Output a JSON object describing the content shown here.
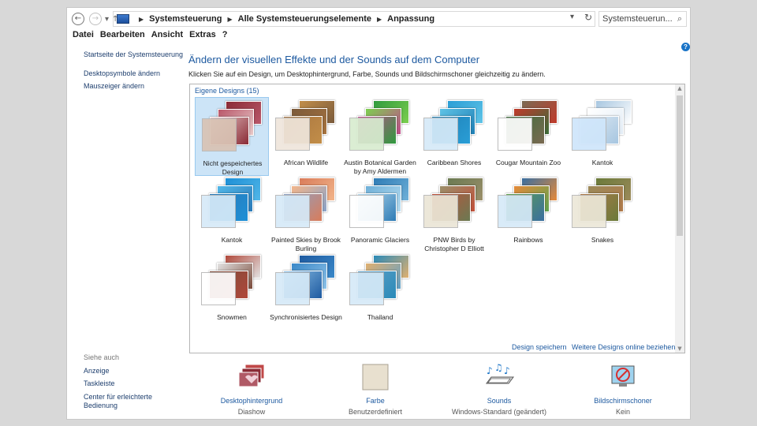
{
  "nav": {
    "back_icon": "arrow-left-icon",
    "forward_icon": "arrow-right-icon",
    "recent_icon": "chevron-down-icon",
    "up_icon": "arrow-up-icon"
  },
  "breadcrumb": [
    "Systemsteuerung",
    "Alle Systemsteuerungselemente",
    "Anpassung"
  ],
  "search": {
    "placeholder": "Systemsteuerun..."
  },
  "menu": [
    "Datei",
    "Bearbeiten",
    "Ansicht",
    "Extras",
    "?"
  ],
  "sidebar": {
    "links": [
      "Startseite der Systemsteuerung",
      "Desktopsymbole ändern",
      "Mauszeiger ändern"
    ],
    "see_also_title": "Siehe auch",
    "see_also": [
      "Anzeige",
      "Taskleiste",
      "Center für erleichterte Bedienung"
    ]
  },
  "main": {
    "title": "Ändern der visuellen Effekte und der Sounds auf dem Computer",
    "subtitle": "Klicken Sie auf ein Design, um Desktophintergrund, Farbe, Sounds und Bildschirmschoner gleichzeitig zu ändern.",
    "group_title": "Eigene Designs (15)",
    "themes": [
      {
        "label": "Nicht gespeichertes Design",
        "selected": true,
        "colors": [
          "#8a2b36",
          "#b9576a",
          "#e8c9c9",
          "#d9c3b4"
        ]
      },
      {
        "label": "African Wildlife",
        "colors": [
          "#c28e49",
          "#7a5a3b",
          "#a8743f",
          "#efe6dc"
        ]
      },
      {
        "label": "Austin Botanical Garden by Amy Aldermen",
        "colors": [
          "#2f9a3e",
          "#7ccf4f",
          "#c24b8d",
          "#d8ecd0"
        ]
      },
      {
        "label": "Caribbean Shores",
        "colors": [
          "#2a9ed6",
          "#5fc3e6",
          "#1e7fb5",
          "#d6eaf8"
        ]
      },
      {
        "label": "Cougar Mountain Zoo",
        "colors": [
          "#7a6a52",
          "#c03a2b",
          "#3a6d3a",
          "#ffffff"
        ]
      },
      {
        "label": "Kantok",
        "colors": [
          "#a7c6e0",
          "#ffffff",
          "#e2ecf5",
          "#cfe6fb"
        ]
      },
      {
        "label": "Kantok",
        "colors": [
          "#1d8fd6",
          "#52b7e8",
          "#2a7ab8",
          "#d6eaf8"
        ]
      },
      {
        "label": "Painted Skies by Brook Burling",
        "colors": [
          "#d97c5a",
          "#f2b58a",
          "#8aa3c9",
          "#d6eaf8"
        ]
      },
      {
        "label": "Panoramic Glaciers",
        "colors": [
          "#2e7bb5",
          "#6fb0d8",
          "#b6dcf0",
          "#ffffff"
        ]
      },
      {
        "label": "PNW Birds by Christopher D Elliott",
        "colors": [
          "#6a7a52",
          "#9b8f6a",
          "#c2503a",
          "#ebe6d6"
        ]
      },
      {
        "label": "Rainbows",
        "colors": [
          "#3a6ea0",
          "#e58a3a",
          "#5fa34f",
          "#d6eaf8"
        ]
      },
      {
        "label": "Snakes",
        "colors": [
          "#6a7a3a",
          "#9c8a5a",
          "#b07a4a",
          "#ece8d8"
        ]
      },
      {
        "label": "Snowmen",
        "colors": [
          "#b0483a",
          "#e2e2e2",
          "#7a4a3a",
          "#ffffff"
        ]
      },
      {
        "label": "Synchronisiertes Design",
        "colors": [
          "#1e5aa0",
          "#3a88c8",
          "#8ec2e8",
          "#d6eaf8"
        ]
      },
      {
        "label": "Thailand",
        "colors": [
          "#2a8ab8",
          "#e0b070",
          "#5fa0c8",
          "#d6eaf8"
        ]
      }
    ],
    "save_link": "Design speichern",
    "online_link": "Weitere Designs online beziehen"
  },
  "bottom": [
    {
      "title": "Desktophintergrund",
      "subtitle": "Diashow",
      "icon": "desktop-background-icon"
    },
    {
      "title": "Farbe",
      "subtitle": "Benutzerdefiniert",
      "icon": "color-swatch-icon"
    },
    {
      "title": "Sounds",
      "subtitle": "Windows-Standard (geändert)",
      "icon": "sounds-icon"
    },
    {
      "title": "Bildschirmschoner",
      "subtitle": "Kein",
      "icon": "screensaver-icon"
    }
  ],
  "colors": {
    "link": "#1e5aa0",
    "selection": "#cce4f7",
    "help": "#1a74c7"
  }
}
